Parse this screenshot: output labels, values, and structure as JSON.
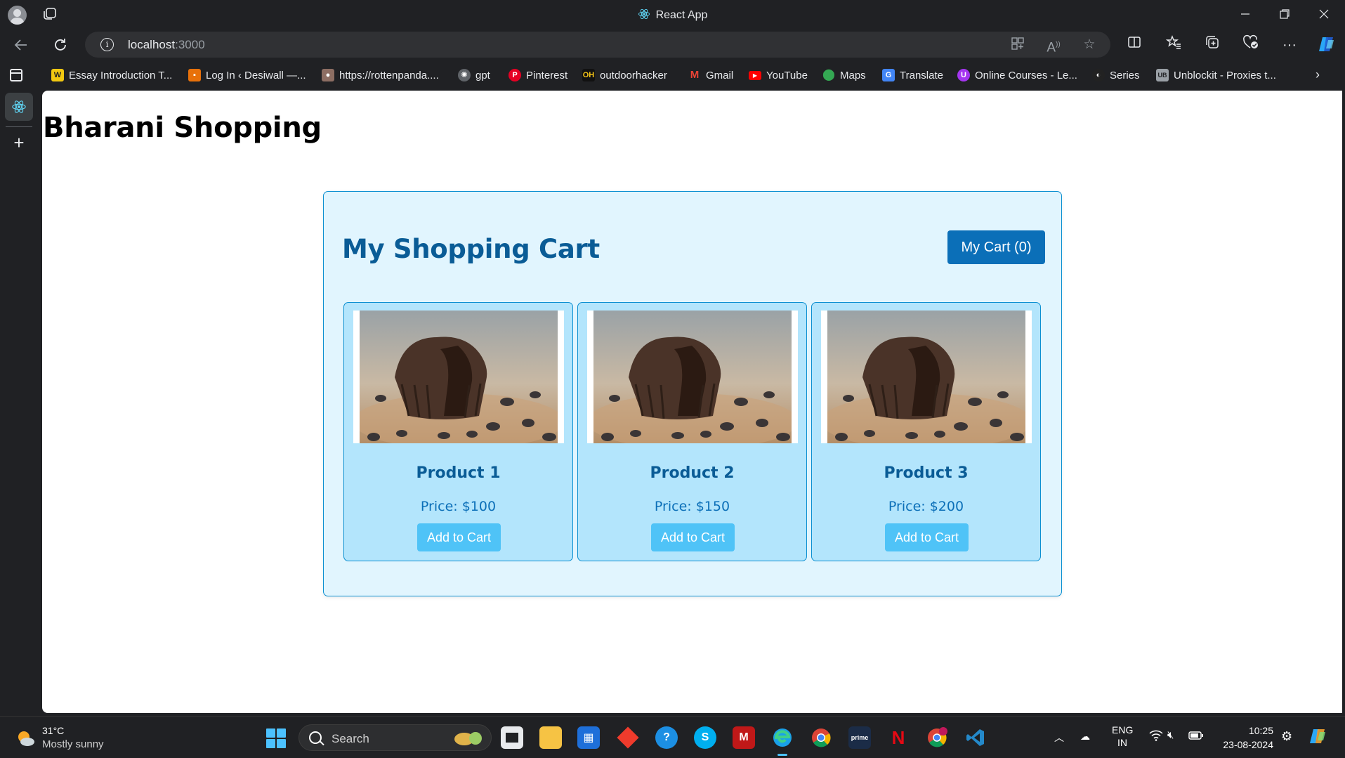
{
  "browser": {
    "window_title": "React App",
    "url_host": "localhost",
    "url_port": ":3000"
  },
  "bookmarks": [
    {
      "label": "Essay Introduction T...",
      "icon": "w-favicon",
      "color": "#f2c811"
    },
    {
      "label": "Log In ‹ Desiwall —...",
      "icon": "desiwall-favicon",
      "color": "#e8710a"
    },
    {
      "label": "https://rottenpanda....",
      "icon": "panda-favicon",
      "color": "#8d6e63"
    },
    {
      "label": "gpt",
      "icon": "openai-favicon",
      "color": "#5f6368"
    },
    {
      "label": "Pinterest",
      "icon": "pinterest-favicon",
      "color": "#e60023"
    },
    {
      "label": "outdoorhacker",
      "icon": "oh-favicon",
      "color": "#111111"
    },
    {
      "label": "Gmail",
      "icon": "gmail-favicon",
      "color": "#ea4335"
    },
    {
      "label": "YouTube",
      "icon": "youtube-favicon",
      "color": "#ff0000"
    },
    {
      "label": "Maps",
      "icon": "maps-favicon",
      "color": "#34a853"
    },
    {
      "label": "Translate",
      "icon": "translate-favicon",
      "color": "#4285f4"
    },
    {
      "label": "Online Courses - Le...",
      "icon": "udemy-favicon",
      "color": "#a435f0"
    },
    {
      "label": "Series",
      "icon": "series-favicon",
      "color": "#222222"
    },
    {
      "label": "Unblockit - Proxies t...",
      "icon": "unblockit-favicon",
      "color": "#9aa0a6"
    }
  ],
  "page": {
    "site_title": "Bharani Shopping",
    "cart_heading": "My Shopping Cart",
    "cart_button": "My Cart (0)",
    "products": [
      {
        "name": "Product 1",
        "price": "Price: $100",
        "button": "Add to Cart"
      },
      {
        "name": "Product 2",
        "price": "Price: $150",
        "button": "Add to Cart"
      },
      {
        "name": "Product 3",
        "price": "Price: $200",
        "button": "Add to Cart"
      }
    ],
    "colors": {
      "panel_bg": "#e1f5fe",
      "card_bg": "#b3e5fc",
      "border": "#0b8fd1",
      "heading": "#0a5c96",
      "cart_button": "#0b6fb8",
      "add_button": "#4fc3f7"
    }
  },
  "taskbar": {
    "weather_temp": "31°C",
    "weather_desc": "Mostly sunny",
    "search_label": "Search",
    "lang_line1": "ENG",
    "lang_line2": "IN",
    "time": "10:25",
    "date": "23-08-2024"
  }
}
